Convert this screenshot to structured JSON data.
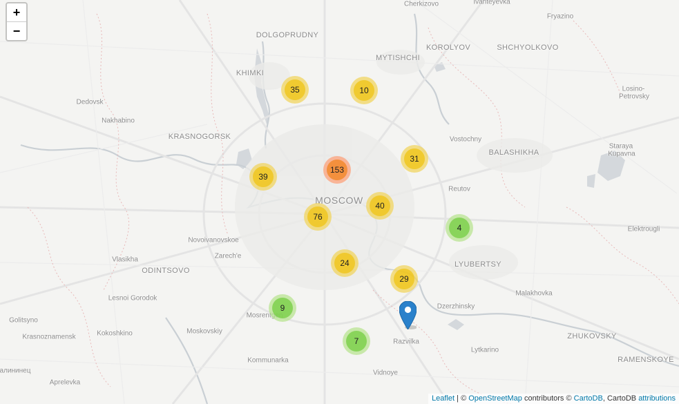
{
  "zoom": {
    "in_label": "+",
    "out_label": "−"
  },
  "places": [
    {
      "id": "cherkizovo",
      "name": "Cherkizovo"
    },
    {
      "id": "ivanteyevka",
      "name": "Ivanteyevka"
    },
    {
      "id": "fryazino",
      "name": "Fryazino"
    },
    {
      "id": "dolgoprudny",
      "name": "DOLGOPRUDNY"
    },
    {
      "id": "mytishchi",
      "name": "MYTISHCHI"
    },
    {
      "id": "korolyov",
      "name": "KOROLYOV"
    },
    {
      "id": "shchyolkovo",
      "name": "SHCHYOLKOVO"
    },
    {
      "id": "khimki",
      "name": "KHIMKI"
    },
    {
      "id": "losino",
      "name": "Losino-"
    },
    {
      "id": "petrovsky",
      "name": "Petrovsky"
    },
    {
      "id": "dedovsk",
      "name": "Dedovsk"
    },
    {
      "id": "nakhabino",
      "name": "Nakhabino"
    },
    {
      "id": "krasnogorsk",
      "name": "KRASNOGORSK"
    },
    {
      "id": "vostochny",
      "name": "Vostochny"
    },
    {
      "id": "balashikha",
      "name": "BALASHIKHA"
    },
    {
      "id": "staraya",
      "name": "Staraya"
    },
    {
      "id": "kupavna",
      "name": "Kupavna"
    },
    {
      "id": "reutov",
      "name": "Reutov"
    },
    {
      "id": "moscow",
      "name": "MOSCOW"
    },
    {
      "id": "elektrougli",
      "name": "Elektrougli"
    },
    {
      "id": "novoivanovskoe",
      "name": "Novoivanovskoe"
    },
    {
      "id": "zarechye",
      "name": "Zarech'e"
    },
    {
      "id": "vlasikha",
      "name": "Vlasikha"
    },
    {
      "id": "odintsovo",
      "name": "ODINTSOVO"
    },
    {
      "id": "lyubertsy",
      "name": "LYUBERTSY"
    },
    {
      "id": "malakhovka",
      "name": "Malakhovka"
    },
    {
      "id": "lesnoi",
      "name": "Lesnoi Gorodok"
    },
    {
      "id": "dzerzhinsky",
      "name": "Dzerzhinsky"
    },
    {
      "id": "mosrentgen",
      "name": "Mosrentgen"
    },
    {
      "id": "golitsyno",
      "name": "Golitsyno"
    },
    {
      "id": "krasnoznamensk",
      "name": "Krasnoznamensk"
    },
    {
      "id": "kokoshkino",
      "name": "Kokoshkino"
    },
    {
      "id": "moskovskiy",
      "name": "Moskovskiy"
    },
    {
      "id": "razvilka",
      "name": "Razvilka"
    },
    {
      "id": "zhukovsky",
      "name": "ZHUKOVSKY"
    },
    {
      "id": "lytkarino",
      "name": "Lytkarino"
    },
    {
      "id": "ramenskoye",
      "name": "RAMENSKOYE"
    },
    {
      "id": "kommunarka",
      "name": "Kommunarka"
    },
    {
      "id": "vidnoye",
      "name": "Vidnoye"
    },
    {
      "id": "alinets",
      "name": "алининец"
    },
    {
      "id": "aprelevka",
      "name": "Aprelevka"
    }
  ],
  "clusters": [
    {
      "id": "c1",
      "count": "35",
      "level": "medium"
    },
    {
      "id": "c2",
      "count": "10",
      "level": "medium"
    },
    {
      "id": "c3",
      "count": "153",
      "level": "large"
    },
    {
      "id": "c4",
      "count": "31",
      "level": "medium"
    },
    {
      "id": "c5",
      "count": "39",
      "level": "medium"
    },
    {
      "id": "c6",
      "count": "40",
      "level": "medium"
    },
    {
      "id": "c7",
      "count": "76",
      "level": "medium"
    },
    {
      "id": "c8",
      "count": "4",
      "level": "small"
    },
    {
      "id": "c9",
      "count": "24",
      "level": "medium"
    },
    {
      "id": "c10",
      "count": "29",
      "level": "medium"
    },
    {
      "id": "c11",
      "count": "9",
      "level": "small"
    },
    {
      "id": "c12",
      "count": "7",
      "level": "small"
    }
  ],
  "cluster_colors": {
    "small": {
      "outer": "#b5e28c",
      "inner": "#6ecc39"
    },
    "medium": {
      "outer": "#f1d357",
      "inner": "#f0c20c"
    },
    "large": {
      "outer": "#fd9c73",
      "inner": "#f18017"
    }
  },
  "marker": {
    "color": "#2a81cb",
    "icon": "map-marker-icon"
  },
  "attribution": {
    "leaflet": "Leaflet",
    "sep": " | © ",
    "osm": "OpenStreetMap",
    "contrib": " contributors © ",
    "cartodb": "CartoDB",
    "comma": ", CartoDB ",
    "attributions": "attributions"
  }
}
